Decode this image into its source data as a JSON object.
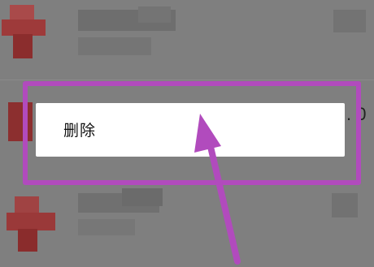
{
  "context_menu": {
    "delete_label": "删除"
  },
  "partial_text": ". 0",
  "annotation": {
    "highlight_color": "#b14bbd",
    "arrow_color": "#b14bbd"
  },
  "icons": {
    "avatar": "avatar-icon"
  }
}
